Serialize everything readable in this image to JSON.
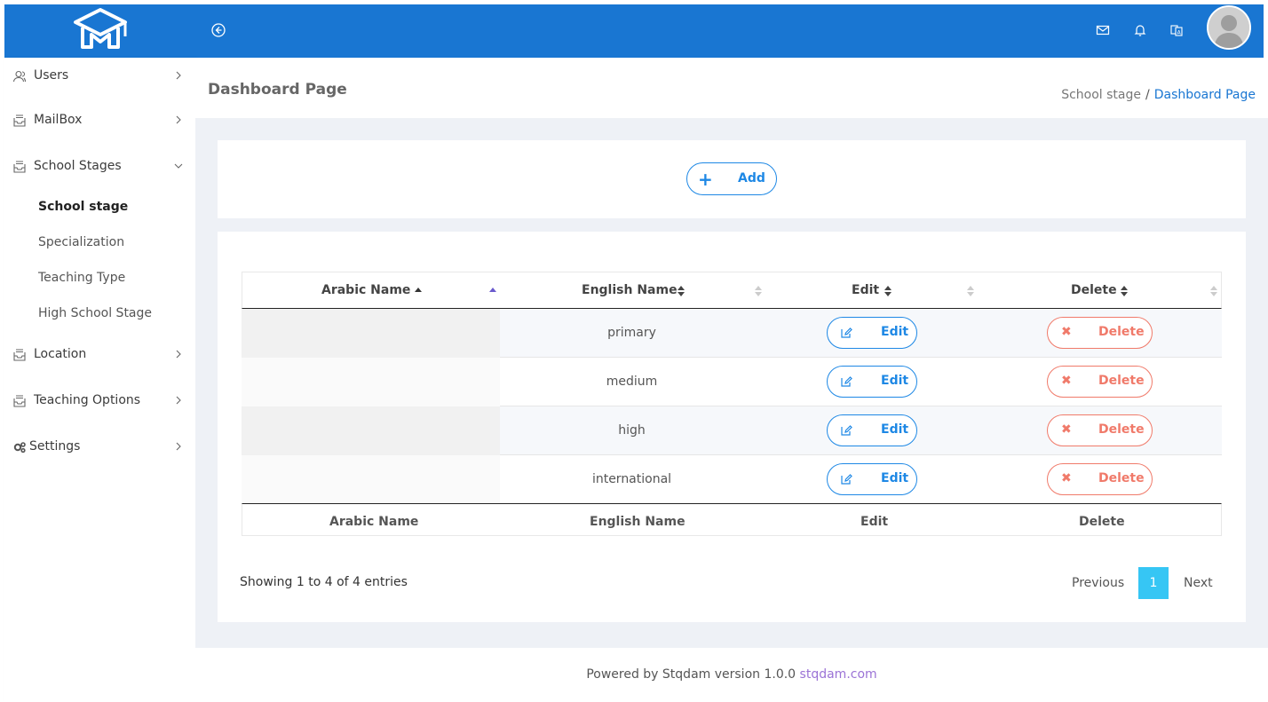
{
  "header": {
    "collapse_icon": "arrow-left-circle-icon",
    "mail_icon": "mail-icon",
    "bell_icon": "bell-icon",
    "lang_icon": "language-icon",
    "brand_color": "#1976d2"
  },
  "sidebar": {
    "items": [
      {
        "label": "Users",
        "icon": "users-icon"
      },
      {
        "label": "MailBox",
        "icon": "mailbox-icon"
      },
      {
        "label": "School Stages",
        "icon": "mailbox-icon"
      },
      {
        "label": "Location",
        "icon": "mailbox-icon"
      },
      {
        "label": "Teaching Options",
        "icon": "mailbox-icon"
      },
      {
        "label": "Settings",
        "icon": "gears-icon"
      }
    ],
    "subitems": [
      {
        "label": "School stage",
        "active": true
      },
      {
        "label": "Specialization"
      },
      {
        "label": "Teaching Type"
      },
      {
        "label": "High School Stage"
      }
    ]
  },
  "page": {
    "title": "Dashboard Page",
    "breadcrumb_parent": "School stage",
    "breadcrumb_sep": "/",
    "breadcrumb_current": "Dashboard Page"
  },
  "toolbar": {
    "add_label": "Add"
  },
  "table": {
    "columns": [
      "Arabic Name",
      "English Name",
      "Edit",
      "Delete"
    ],
    "rows": [
      {
        "arabic": "",
        "english": "primary",
        "edit": "Edit",
        "delete": "Delete"
      },
      {
        "arabic": "",
        "english": "medium",
        "edit": "Edit",
        "delete": "Delete"
      },
      {
        "arabic": "",
        "english": "high",
        "edit": "Edit",
        "delete": "Delete"
      },
      {
        "arabic": "",
        "english": "international",
        "edit": "Edit",
        "delete": "Delete"
      }
    ],
    "footer_columns": [
      "Arabic Name",
      "English Name",
      "Edit",
      "Delete"
    ]
  },
  "pagination": {
    "info": "Showing 1 to 4 of 4 entries",
    "previous": "Previous",
    "current": "1",
    "next": "Next"
  },
  "footer": {
    "text": "Powered by Stqdam version 1.0.0",
    "link": "stqdam.com"
  }
}
